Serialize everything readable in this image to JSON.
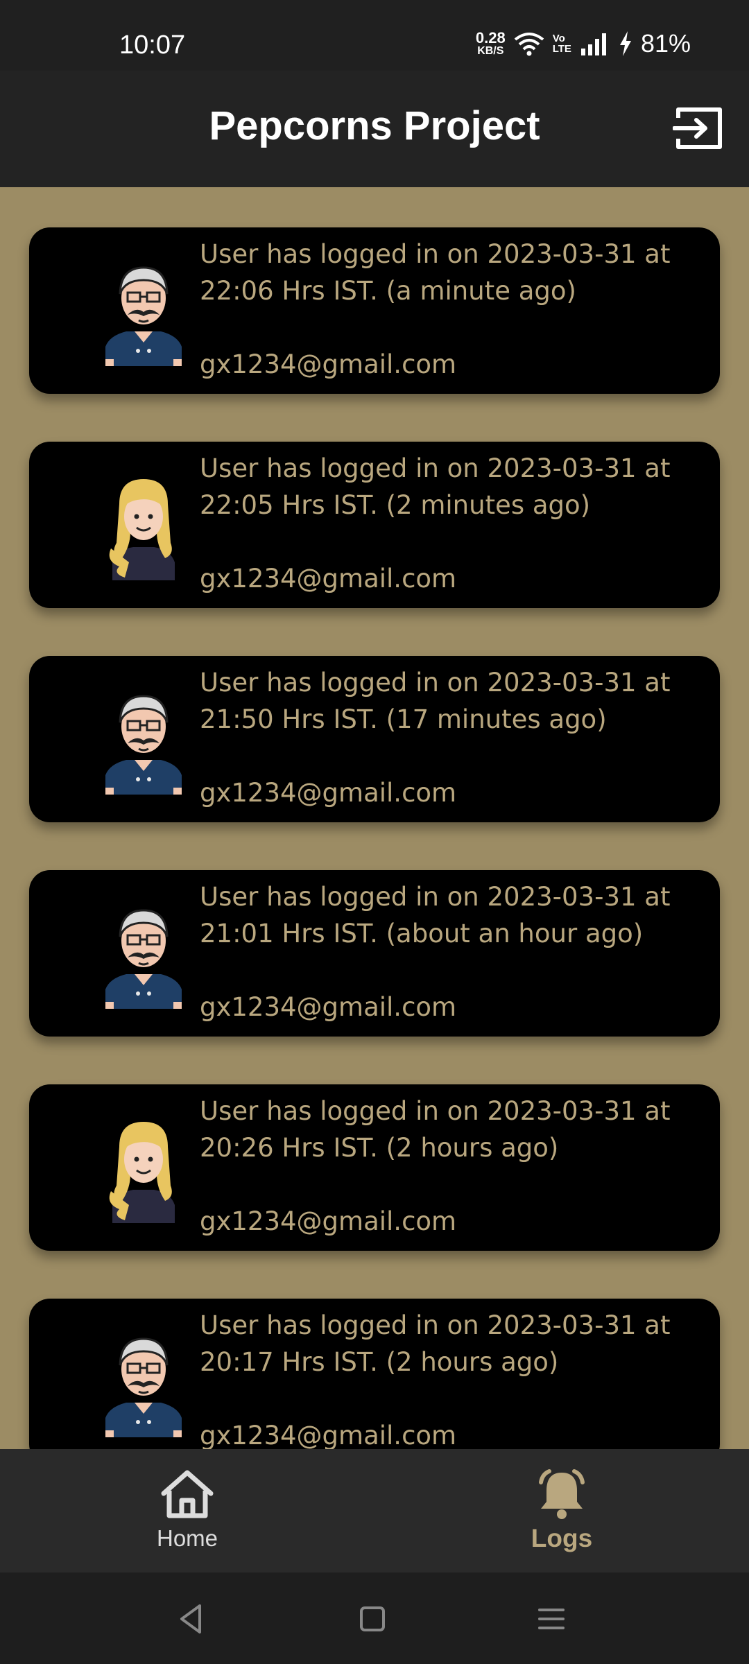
{
  "status_bar": {
    "time": "10:07",
    "net_speed_value": "0.28",
    "net_speed_unit": "KB/S",
    "volte_top": "Vo",
    "volte_bottom": "LTE",
    "battery": "81%"
  },
  "header": {
    "title": "Pepcorns Project"
  },
  "logs": [
    {
      "message": "User has logged in on 2023-03-31 at 22:06 Hrs IST. (a minute ago)",
      "email": "gx1234@gmail.com",
      "avatar": "old-man-avatar"
    },
    {
      "message": "User has logged in on 2023-03-31 at 22:05 Hrs IST. (2 minutes ago)",
      "email": "gx1234@gmail.com",
      "avatar": "blonde-woman-avatar"
    },
    {
      "message": "User has logged in on 2023-03-31 at 21:50 Hrs IST. (17 minutes ago)",
      "email": "gx1234@gmail.com",
      "avatar": "old-man-avatar"
    },
    {
      "message": "User has logged in on 2023-03-31 at 21:01 Hrs IST. (about an hour ago)",
      "email": "gx1234@gmail.com",
      "avatar": "old-man-avatar"
    },
    {
      "message": "User has logged in on 2023-03-31 at 20:26 Hrs IST. (2 hours ago)",
      "email": "gx1234@gmail.com",
      "avatar": "blonde-woman-avatar"
    },
    {
      "message": "User has logged in on 2023-03-31 at 20:17 Hrs IST. (2 hours ago)",
      "email": "gx1234@gmail.com",
      "avatar": "old-man-avatar"
    }
  ],
  "bottom_nav": {
    "home_label": "Home",
    "logs_label": "Logs",
    "active": "Logs"
  },
  "colors": {
    "accent": "#b9a77f",
    "content_bg": "#9c8c64",
    "card_bg": "#000000"
  }
}
